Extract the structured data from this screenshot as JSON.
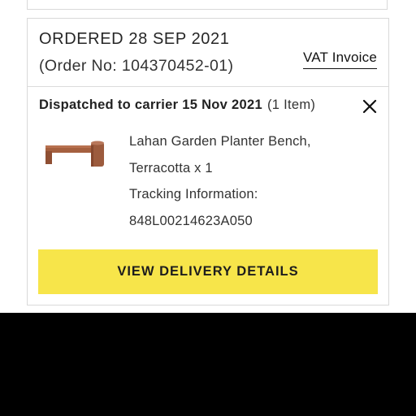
{
  "order": {
    "title": "ORDERED 28 SEP 2021",
    "number": "(Order No: 104370452-01)",
    "vat_link": "VAT Invoice"
  },
  "shipment": {
    "status": "Dispatched to carrier 15 Nov 2021",
    "item_count": "(1 Item)",
    "close_icon": "close-icon"
  },
  "product": {
    "name_line1": "Lahan Garden Planter Bench,",
    "name_line2": "Terracotta x 1",
    "tracking_label": "Tracking Information:",
    "tracking_number": "848L00214623A050",
    "image_icon": "planter-bench-image"
  },
  "actions": {
    "view_delivery": "VIEW DELIVERY DETAILS"
  },
  "colors": {
    "button_bg": "#f7e54a",
    "border": "#d9d9d9",
    "product": "#9c5b3d",
    "bottom_band": "#000000"
  }
}
